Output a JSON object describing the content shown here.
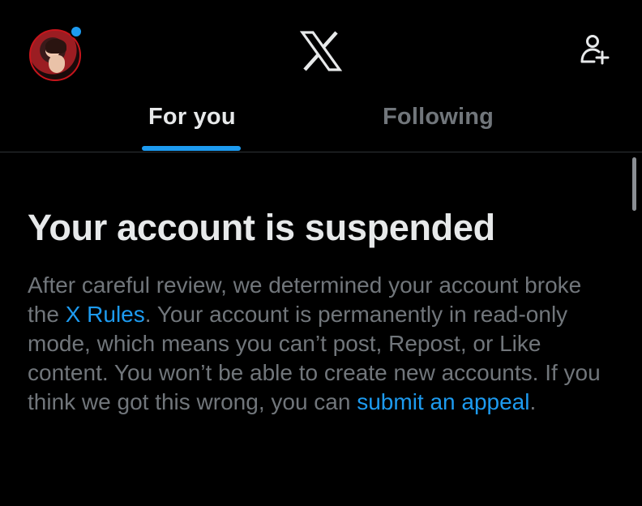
{
  "header": {
    "logo_icon": "x-logo-icon",
    "follow_icon": "add-person-icon",
    "avatar_notification": true
  },
  "tabs": [
    {
      "label": "For you",
      "active": true
    },
    {
      "label": "Following",
      "active": false
    }
  ],
  "notice": {
    "title": "Your account is suspended",
    "body_part1": "After careful review, we determined your account broke the ",
    "rules_link": "X Rules",
    "body_part2": ". Your account is permanently in read-only mode, which means you can’t post, Repost, or Like content. You won’t be able to create new accounts. If you think we got this wrong, you can ",
    "appeal_link": "submit an appeal",
    "body_part3": "."
  },
  "colors": {
    "background": "#000000",
    "primary_text": "#e7e9ea",
    "secondary_text": "#71767b",
    "accent": "#1d9bf0",
    "divider": "#2f3336"
  }
}
